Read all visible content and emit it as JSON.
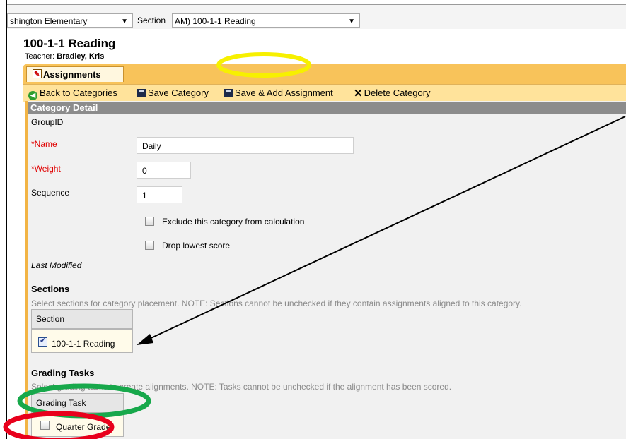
{
  "header": {
    "school_select": "shington Elementary",
    "section_label": "Section",
    "section_select": "AM) 100-1-1 Reading"
  },
  "page": {
    "title": "100-1-1 Reading",
    "teacher_label": "Teacher:",
    "teacher_name": "Bradley, Kris"
  },
  "tabs": [
    {
      "label": "Assignments"
    }
  ],
  "toolbar": {
    "back": "Back to Categories",
    "save": "Save Category",
    "save_add": "Save & Add Assignment",
    "delete": "Delete Category"
  },
  "detail": {
    "header": "Category Detail",
    "groupid_label": "GroupID",
    "name_label": "*Name",
    "name_value": "Daily",
    "weight_label": "*Weight",
    "weight_value": "0",
    "sequence_label": "Sequence",
    "sequence_value": "1",
    "exclude_label": "Exclude this category from calculation",
    "drop_lowest_label": "Drop lowest score",
    "last_modified_label": "Last Modified"
  },
  "sections": {
    "title": "Sections",
    "hint": "Select sections for category placement. NOTE: Sections cannot be unchecked if they contain assignments aligned to this category.",
    "column": "Section",
    "rows": [
      {
        "label": "100-1-1 Reading",
        "checked": true
      }
    ]
  },
  "grading_tasks": {
    "title": "Grading Tasks",
    "hint": "Select grading tasks to create alignments. NOTE: Tasks cannot be unchecked if the alignment has been scored.",
    "column": "Grading Task",
    "rows": [
      {
        "label": "Quarter Grade",
        "checked": false
      }
    ]
  },
  "annotations": {
    "yellow": "#f7f000",
    "green": "#17a84b",
    "red": "#e8001c",
    "arrow": "#000000"
  }
}
